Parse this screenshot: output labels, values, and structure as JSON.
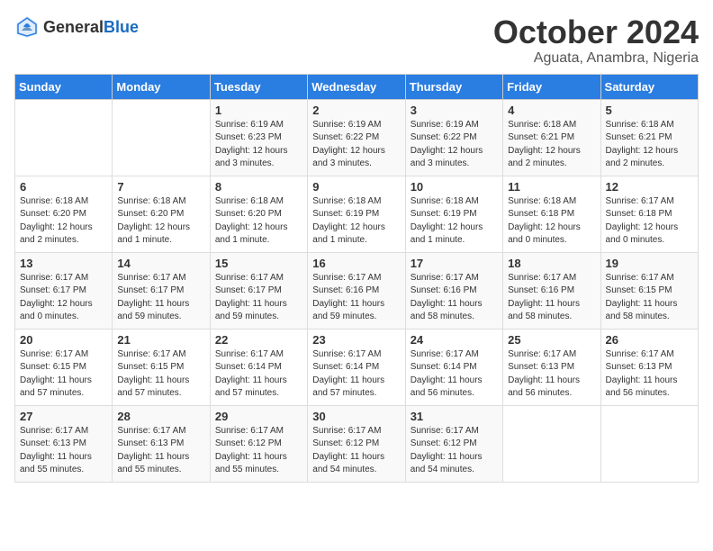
{
  "header": {
    "logo_general": "General",
    "logo_blue": "Blue",
    "month": "October 2024",
    "location": "Aguata, Anambra, Nigeria"
  },
  "days_of_week": [
    "Sunday",
    "Monday",
    "Tuesday",
    "Wednesday",
    "Thursday",
    "Friday",
    "Saturday"
  ],
  "weeks": [
    [
      {
        "day": "",
        "content": ""
      },
      {
        "day": "",
        "content": ""
      },
      {
        "day": "1",
        "content": "Sunrise: 6:19 AM\nSunset: 6:23 PM\nDaylight: 12 hours and 3 minutes."
      },
      {
        "day": "2",
        "content": "Sunrise: 6:19 AM\nSunset: 6:22 PM\nDaylight: 12 hours and 3 minutes."
      },
      {
        "day": "3",
        "content": "Sunrise: 6:19 AM\nSunset: 6:22 PM\nDaylight: 12 hours and 3 minutes."
      },
      {
        "day": "4",
        "content": "Sunrise: 6:18 AM\nSunset: 6:21 PM\nDaylight: 12 hours and 2 minutes."
      },
      {
        "day": "5",
        "content": "Sunrise: 6:18 AM\nSunset: 6:21 PM\nDaylight: 12 hours and 2 minutes."
      }
    ],
    [
      {
        "day": "6",
        "content": "Sunrise: 6:18 AM\nSunset: 6:20 PM\nDaylight: 12 hours and 2 minutes."
      },
      {
        "day": "7",
        "content": "Sunrise: 6:18 AM\nSunset: 6:20 PM\nDaylight: 12 hours and 1 minute."
      },
      {
        "day": "8",
        "content": "Sunrise: 6:18 AM\nSunset: 6:20 PM\nDaylight: 12 hours and 1 minute."
      },
      {
        "day": "9",
        "content": "Sunrise: 6:18 AM\nSunset: 6:19 PM\nDaylight: 12 hours and 1 minute."
      },
      {
        "day": "10",
        "content": "Sunrise: 6:18 AM\nSunset: 6:19 PM\nDaylight: 12 hours and 1 minute."
      },
      {
        "day": "11",
        "content": "Sunrise: 6:18 AM\nSunset: 6:18 PM\nDaylight: 12 hours and 0 minutes."
      },
      {
        "day": "12",
        "content": "Sunrise: 6:17 AM\nSunset: 6:18 PM\nDaylight: 12 hours and 0 minutes."
      }
    ],
    [
      {
        "day": "13",
        "content": "Sunrise: 6:17 AM\nSunset: 6:17 PM\nDaylight: 12 hours and 0 minutes."
      },
      {
        "day": "14",
        "content": "Sunrise: 6:17 AM\nSunset: 6:17 PM\nDaylight: 11 hours and 59 minutes."
      },
      {
        "day": "15",
        "content": "Sunrise: 6:17 AM\nSunset: 6:17 PM\nDaylight: 11 hours and 59 minutes."
      },
      {
        "day": "16",
        "content": "Sunrise: 6:17 AM\nSunset: 6:16 PM\nDaylight: 11 hours and 59 minutes."
      },
      {
        "day": "17",
        "content": "Sunrise: 6:17 AM\nSunset: 6:16 PM\nDaylight: 11 hours and 58 minutes."
      },
      {
        "day": "18",
        "content": "Sunrise: 6:17 AM\nSunset: 6:16 PM\nDaylight: 11 hours and 58 minutes."
      },
      {
        "day": "19",
        "content": "Sunrise: 6:17 AM\nSunset: 6:15 PM\nDaylight: 11 hours and 58 minutes."
      }
    ],
    [
      {
        "day": "20",
        "content": "Sunrise: 6:17 AM\nSunset: 6:15 PM\nDaylight: 11 hours and 57 minutes."
      },
      {
        "day": "21",
        "content": "Sunrise: 6:17 AM\nSunset: 6:15 PM\nDaylight: 11 hours and 57 minutes."
      },
      {
        "day": "22",
        "content": "Sunrise: 6:17 AM\nSunset: 6:14 PM\nDaylight: 11 hours and 57 minutes."
      },
      {
        "day": "23",
        "content": "Sunrise: 6:17 AM\nSunset: 6:14 PM\nDaylight: 11 hours and 57 minutes."
      },
      {
        "day": "24",
        "content": "Sunrise: 6:17 AM\nSunset: 6:14 PM\nDaylight: 11 hours and 56 minutes."
      },
      {
        "day": "25",
        "content": "Sunrise: 6:17 AM\nSunset: 6:13 PM\nDaylight: 11 hours and 56 minutes."
      },
      {
        "day": "26",
        "content": "Sunrise: 6:17 AM\nSunset: 6:13 PM\nDaylight: 11 hours and 56 minutes."
      }
    ],
    [
      {
        "day": "27",
        "content": "Sunrise: 6:17 AM\nSunset: 6:13 PM\nDaylight: 11 hours and 55 minutes."
      },
      {
        "day": "28",
        "content": "Sunrise: 6:17 AM\nSunset: 6:13 PM\nDaylight: 11 hours and 55 minutes."
      },
      {
        "day": "29",
        "content": "Sunrise: 6:17 AM\nSunset: 6:12 PM\nDaylight: 11 hours and 55 minutes."
      },
      {
        "day": "30",
        "content": "Sunrise: 6:17 AM\nSunset: 6:12 PM\nDaylight: 11 hours and 54 minutes."
      },
      {
        "day": "31",
        "content": "Sunrise: 6:17 AM\nSunset: 6:12 PM\nDaylight: 11 hours and 54 minutes."
      },
      {
        "day": "",
        "content": ""
      },
      {
        "day": "",
        "content": ""
      }
    ]
  ]
}
